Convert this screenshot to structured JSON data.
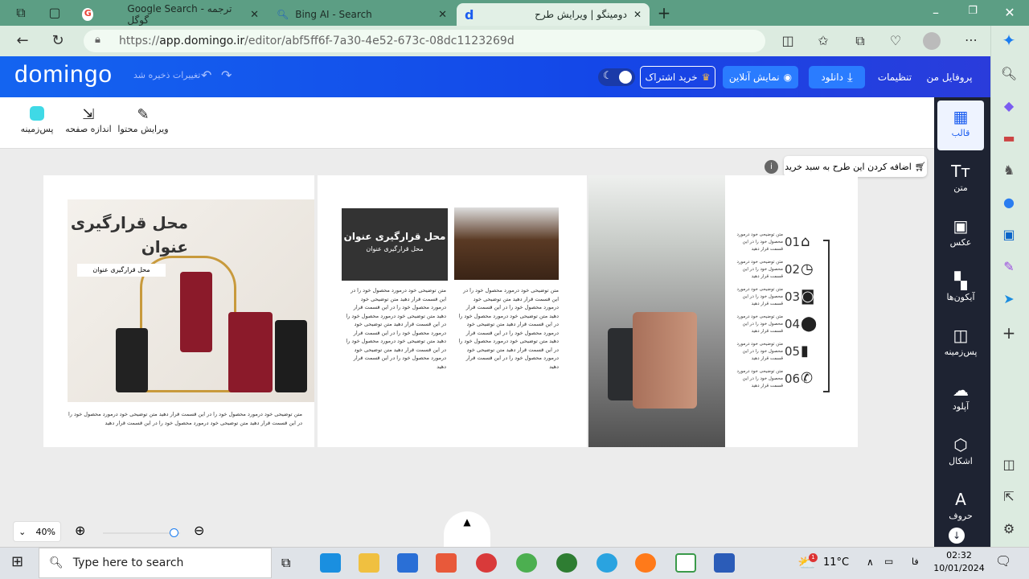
{
  "browser": {
    "tabs": [
      {
        "label": "Google Search - ترجمه گوگل",
        "icon": "google-icon"
      },
      {
        "label": "Bing AI - Search",
        "icon": "search-icon"
      },
      {
        "label": "دومینگو | ویرایش طرح",
        "icon": "domingo-icon",
        "active": true
      }
    ],
    "url_prefix": "https://",
    "url_domain": "app.domingo.ir",
    "url_path": "/editor/abf5ff6f-7a30-4e52-673c-08dc1123269d"
  },
  "header": {
    "logo": "domingo",
    "save_status": "تغییرات ذخیره شد",
    "profile": "پروفایل من",
    "settings": "تنظیمات",
    "download": "دانلود",
    "preview": "نمایش آنلاین",
    "subscribe": "خرید اشتراک"
  },
  "toolbar": {
    "edit": "ویرایش محتوا",
    "resize": "اندازه صفحه",
    "background": "پس‌زمینه",
    "background_color": "#3fd9e6"
  },
  "canvas": {
    "add_to_cart": "اضافه کردن این طرح به سبد خرید",
    "left_page": {
      "title": "محل قرارگیری عنوان",
      "subtitle": "محل قرارگیری عنوان",
      "body": "متن توضیحی خود درمورد محصول خود را در این قسمت قرار دهید متن توضیحی خود درمورد محصول خود را در این قسمت قرار دهید متن توضیحی خود درمورد محصول خود را در این قسمت قرار دهید"
    },
    "middle_page": {
      "title": "محل قرارگیری عنوان",
      "subtitle": "محل قرارگیری عنوان",
      "body": "متن توضیحی خود درمورد محصول خود را در این قسمت قرار دهید متن توضیحی خود درمورد محصول خود را در این قسمت قرار دهید متن توضیحی خود درمورد محصول خود را در این قسمت قرار دهید متن توضیحی خود درمورد محصول خود را در این قسمت قرار دهید متن توضیحی خود درمورد محصول خود را در این قسمت قرار دهید متن توضیحی خود درمورد محصول خود را در این قسمت قرار دهید"
    },
    "right_page": {
      "items": [
        {
          "num": "01",
          "icon": "home-icon",
          "glyph": "⌂",
          "text": "متن توضیحی خود درمورد محصول خود را در این قسمت قرار دهید"
        },
        {
          "num": "02",
          "icon": "clock-icon",
          "glyph": "◷",
          "text": "متن توضیحی خود درمورد محصول خود را در این قسمت قرار دهید"
        },
        {
          "num": "03",
          "icon": "camera-icon",
          "glyph": "◙",
          "text": "متن توضیحی خود درمورد محصول خود را در این قسمت قرار دهید"
        },
        {
          "num": "04",
          "icon": "location-pin-icon",
          "glyph": "⬤",
          "text": "متن توضیحی خود درمورد محصول خود را در این قسمت قرار دهید"
        },
        {
          "num": "05",
          "icon": "bar-chart-icon",
          "glyph": "▮",
          "text": "متن توضیحی خود درمورد محصول خود را در این قسمت قرار دهید"
        },
        {
          "num": "06",
          "icon": "phone-icon",
          "glyph": "✆",
          "text": "متن توضیحی خود درمورد محصول خود را در این قسمت قرار دهید"
        }
      ]
    }
  },
  "sidebar": {
    "items": [
      {
        "label": "قالب",
        "glyph": "▦",
        "icon": "template-icon",
        "selected": true
      },
      {
        "label": "متن",
        "glyph": "Tт",
        "icon": "text-icon"
      },
      {
        "label": "عکس",
        "glyph": "▣",
        "icon": "image-icon"
      },
      {
        "label": "آیکون‌ها",
        "glyph": "▚",
        "icon": "icons-icon"
      },
      {
        "label": "پس‌زمینه",
        "glyph": "◫",
        "icon": "background-icon"
      },
      {
        "label": "آپلود",
        "glyph": "☁",
        "icon": "upload-icon"
      },
      {
        "label": "اشکال",
        "glyph": "⬡",
        "icon": "shapes-icon"
      },
      {
        "label": "حروف",
        "glyph": "A",
        "icon": "font-icon"
      }
    ]
  },
  "zoom": {
    "value": "40%",
    "level": 0.4
  },
  "taskbar": {
    "search_placeholder": "Type here to search",
    "temperature": "11°C",
    "language": "فا",
    "time": "02:32",
    "date": "10/01/2024",
    "weather_badge": "1"
  }
}
